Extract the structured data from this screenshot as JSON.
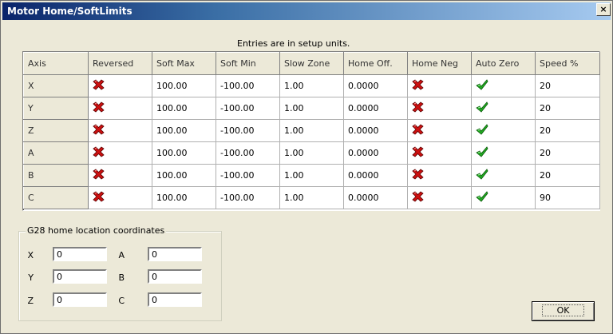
{
  "window": {
    "title": "Motor Home/SoftLimits",
    "close_label": "×"
  },
  "units_note": "Entries are in setup units.",
  "grid": {
    "columns": [
      "Axis",
      "Reversed",
      "Soft Max",
      "Soft Min",
      "Slow Zone",
      "Home Off.",
      "Home Neg",
      "Auto Zero",
      "Speed %"
    ],
    "rows": [
      {
        "axis": "X",
        "reversed": false,
        "soft_max": "100.00",
        "soft_min": "-100.00",
        "slow_zone": "1.00",
        "home_off": "0.0000",
        "home_neg": false,
        "auto_zero": true,
        "speed": "20"
      },
      {
        "axis": "Y",
        "reversed": false,
        "soft_max": "100.00",
        "soft_min": "-100.00",
        "slow_zone": "1.00",
        "home_off": "0.0000",
        "home_neg": false,
        "auto_zero": true,
        "speed": "20"
      },
      {
        "axis": "Z",
        "reversed": false,
        "soft_max": "100.00",
        "soft_min": "-100.00",
        "slow_zone": "1.00",
        "home_off": "0.0000",
        "home_neg": false,
        "auto_zero": true,
        "speed": "20"
      },
      {
        "axis": "A",
        "reversed": false,
        "soft_max": "100.00",
        "soft_min": "-100.00",
        "slow_zone": "1.00",
        "home_off": "0.0000",
        "home_neg": false,
        "auto_zero": true,
        "speed": "20"
      },
      {
        "axis": "B",
        "reversed": false,
        "soft_max": "100.00",
        "soft_min": "-100.00",
        "slow_zone": "1.00",
        "home_off": "0.0000",
        "home_neg": false,
        "auto_zero": true,
        "speed": "20"
      },
      {
        "axis": "C",
        "reversed": false,
        "soft_max": "100.00",
        "soft_min": "-100.00",
        "slow_zone": "1.00",
        "home_off": "0.0000",
        "home_neg": false,
        "auto_zero": true,
        "speed": "90"
      }
    ]
  },
  "icons": {
    "false": "red-x-icon",
    "true": "green-check-icon",
    "false_color": "#cc1010",
    "true_color": "#22aa22"
  },
  "g28": {
    "label": "G28 home location coordinates",
    "coords": [
      {
        "label": "X",
        "value": "0"
      },
      {
        "label": "Y",
        "value": "0"
      },
      {
        "label": "Z",
        "value": "0"
      },
      {
        "label": "A",
        "value": "0"
      },
      {
        "label": "B",
        "value": "0"
      },
      {
        "label": "C",
        "value": "0"
      }
    ]
  },
  "ok_label": "OK"
}
